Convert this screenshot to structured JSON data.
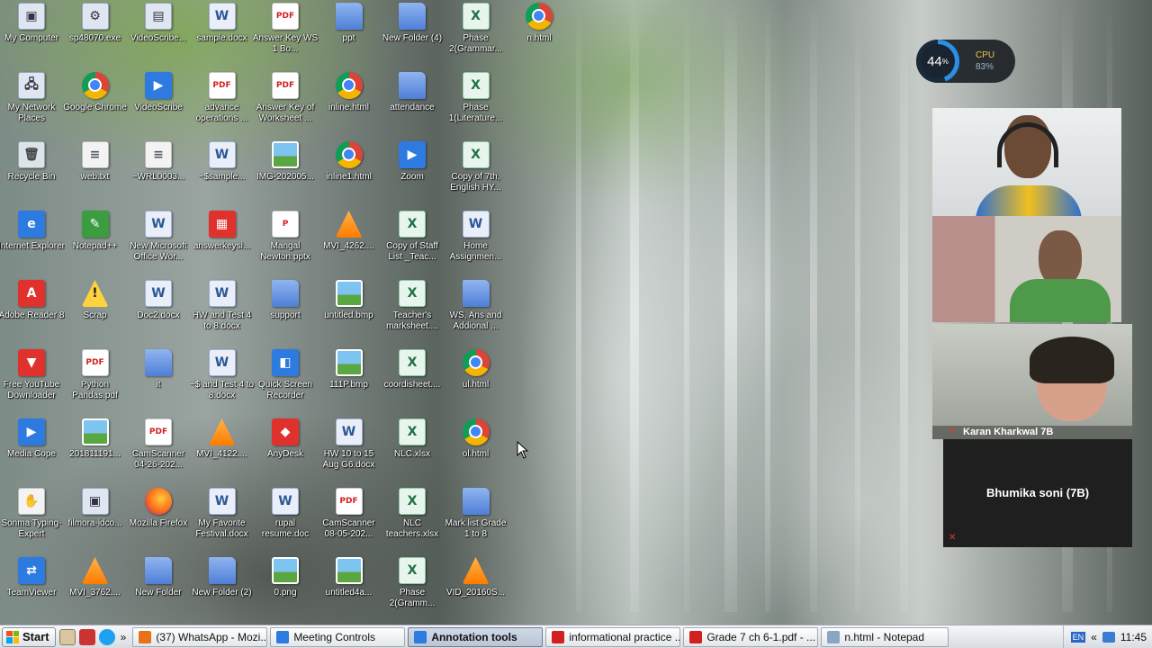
{
  "desktop": {
    "icons": [
      {
        "label": "My Computer",
        "type": "exe",
        "glyph": "▣"
      },
      {
        "label": "sp48070.exe",
        "type": "exe",
        "glyph": "⚙"
      },
      {
        "label": "VideoScribe...",
        "type": "exe",
        "glyph": "▤"
      },
      {
        "label": "sample.docx",
        "type": "word",
        "glyph": "W"
      },
      {
        "label": "Answer Key WS 1 Bo...",
        "type": "pdf",
        "glyph": "PDF"
      },
      {
        "label": "ppt",
        "type": "folder",
        "glyph": ""
      },
      {
        "label": "New Folder (4)",
        "type": "folder",
        "glyph": ""
      },
      {
        "label": "Phase 2(Grammar...",
        "type": "excel",
        "glyph": "X"
      },
      {
        "label": "n.html",
        "type": "chrome",
        "glyph": ""
      },
      {
        "label": "My Network Places",
        "type": "exe",
        "glyph": "🖧"
      },
      {
        "label": "Google Chrome",
        "type": "chrome",
        "glyph": ""
      },
      {
        "label": "VideoScribe",
        "type": "blue",
        "glyph": "▶"
      },
      {
        "label": "advance operations ...",
        "type": "pdf",
        "glyph": "PDF"
      },
      {
        "label": "Answer Key of Worksheet ...",
        "type": "pdf",
        "glyph": "PDF"
      },
      {
        "label": "inline.html",
        "type": "chrome",
        "glyph": ""
      },
      {
        "label": "attendance",
        "type": "folder",
        "glyph": ""
      },
      {
        "label": "Phase 1(Literature...",
        "type": "excel",
        "glyph": "X"
      },
      {
        "label": "Recycle Bin",
        "type": "bin",
        "glyph": "🗑"
      },
      {
        "label": "web.txt",
        "type": "txt",
        "glyph": "≡"
      },
      {
        "label": "~WRL0003...",
        "type": "txt",
        "glyph": "≡"
      },
      {
        "label": "~$sample...",
        "type": "word",
        "glyph": "W"
      },
      {
        "label": "IMG-202005...",
        "type": "img",
        "glyph": ""
      },
      {
        "label": "inline1.html",
        "type": "chrome",
        "glyph": ""
      },
      {
        "label": "Zoom",
        "type": "blue",
        "glyph": "▶"
      },
      {
        "label": "Copy of 7th, English HY...",
        "type": "excel",
        "glyph": "X"
      },
      {
        "label": "Internet Explorer",
        "type": "blue",
        "glyph": "e"
      },
      {
        "label": "Notepad++",
        "type": "green",
        "glyph": "✎"
      },
      {
        "label": "New Microsoft Office Wor...",
        "type": "word",
        "glyph": "W"
      },
      {
        "label": "answerkeysi...",
        "type": "red",
        "glyph": "▦"
      },
      {
        "label": "Mangal Newton.pptx",
        "type": "pdf",
        "glyph": "P"
      },
      {
        "label": "MVI_4262....",
        "type": "vlc",
        "glyph": ""
      },
      {
        "label": "Copy of Staff List _Teac...",
        "type": "excel",
        "glyph": "X"
      },
      {
        "label": "Home Assignmen...",
        "type": "word",
        "glyph": "W"
      },
      {
        "label": "Adobe Reader 8",
        "type": "red",
        "glyph": "A"
      },
      {
        "label": "Scrap",
        "type": "warn",
        "glyph": "!"
      },
      {
        "label": "Doc2.docx",
        "type": "word",
        "glyph": "W"
      },
      {
        "label": "HW and Test 4 to 8.docx",
        "type": "word",
        "glyph": "W"
      },
      {
        "label": "support",
        "type": "folder",
        "glyph": ""
      },
      {
        "label": "untitled.bmp",
        "type": "img",
        "glyph": ""
      },
      {
        "label": "Teacher's marksheet....",
        "type": "excel",
        "glyph": "X"
      },
      {
        "label": "WS, Ans and Addional ...",
        "type": "folder",
        "glyph": ""
      },
      {
        "label": "Free YouTube Downloader",
        "type": "red",
        "glyph": "▼"
      },
      {
        "label": "Python Pandas.pdf",
        "type": "pdf",
        "glyph": "PDF"
      },
      {
        "label": "",
        "type": "none",
        "glyph": ""
      },
      {
        "label": "~$ and Test 4 to 8.docx",
        "type": "word",
        "glyph": "W"
      },
      {
        "label": "Quick Screen Recorder",
        "type": "blue",
        "glyph": "◧"
      },
      {
        "label": "111P.bmp",
        "type": "img",
        "glyph": ""
      },
      {
        "label": "coordisheet....",
        "type": "excel",
        "glyph": "X"
      },
      {
        "label": "ul.html",
        "type": "chrome",
        "glyph": ""
      },
      {
        "label": "Media Cope",
        "type": "blue",
        "glyph": "▶"
      },
      {
        "label": "201811191...",
        "type": "img",
        "glyph": ""
      },
      {
        "label": "CamScanner 04-26-202...",
        "type": "pdf",
        "glyph": "PDF"
      },
      {
        "label": "MVI_4122....",
        "type": "vlc",
        "glyph": ""
      },
      {
        "label": "AnyDesk",
        "type": "red",
        "glyph": "◆"
      },
      {
        "label": "HW 10 to 15 Aug G6.docx",
        "type": "word",
        "glyph": "W"
      },
      {
        "label": "NLC.xlsx",
        "type": "excel",
        "glyph": "X"
      },
      {
        "label": "ol.html",
        "type": "chrome",
        "glyph": ""
      },
      {
        "label": "Sonma Typing-Expert",
        "type": "txt",
        "glyph": "✋"
      },
      {
        "label": "filmora-idco...",
        "type": "exe",
        "glyph": "▣"
      },
      {
        "label": "Mozilla Firefox",
        "type": "firefox",
        "glyph": ""
      },
      {
        "label": "My Favorite Festival.docx",
        "type": "word",
        "glyph": "W"
      },
      {
        "label": "rupal resume.doc",
        "type": "word",
        "glyph": "W"
      },
      {
        "label": "CamScanner 08-05-202...",
        "type": "pdf",
        "glyph": "PDF"
      },
      {
        "label": "NLC teachers.xlsx",
        "type": "excel",
        "glyph": "X"
      },
      {
        "label": "Mark list Grade 1 to 8",
        "type": "folder",
        "glyph": ""
      },
      {
        "label": "TeamViewer",
        "type": "blue",
        "glyph": "⇄"
      },
      {
        "label": "MVI_3762....",
        "type": "vlc",
        "glyph": ""
      },
      {
        "label": "New Folder",
        "type": "folder",
        "glyph": ""
      },
      {
        "label": "New Folder (2)",
        "type": "folder",
        "glyph": ""
      },
      {
        "label": "0.png",
        "type": "img",
        "glyph": ""
      },
      {
        "label": "untitled4a...",
        "type": "img",
        "glyph": ""
      },
      {
        "label": "Phase 2(Gramm...",
        "type": "excel",
        "glyph": "X"
      },
      {
        "label": "VID_20160S...",
        "type": "vlc",
        "glyph": ""
      }
    ],
    "extra_icon_it": {
      "label": "it",
      "type": "folder",
      "glyph": ""
    }
  },
  "cpu_widget": {
    "percent": "44",
    "percent_sign": "%",
    "label": "CPU",
    "value": "83",
    "value_sign": "%"
  },
  "zoom_panel": {
    "participants": [
      {
        "name": "",
        "muted": false
      },
      {
        "name": "",
        "muted": false
      },
      {
        "name": "Karan Kharkwal 7B",
        "muted": true
      },
      {
        "name": "Bhumika soni (7B)",
        "muted": true
      }
    ]
  },
  "taskbar": {
    "start_label": "Start",
    "chevron": "»",
    "tasks": [
      {
        "label": "(37) WhatsApp - Mozi...",
        "active": false,
        "icon_color": "#e8711c"
      },
      {
        "label": "Meeting Controls",
        "active": false,
        "icon_color": "#2d7be0"
      },
      {
        "label": "Annotation tools",
        "active": true,
        "icon_color": "#2d7be0"
      },
      {
        "label": "informational practice ...",
        "active": false,
        "icon_color": "#d21f1f"
      },
      {
        "label": "Grade 7 ch 6-1.pdf - ...",
        "active": false,
        "icon_color": "#d21f1f"
      },
      {
        "label": "n.html - Notepad",
        "active": false,
        "icon_color": "#8aa6c4"
      }
    ],
    "tray": {
      "lang": "EN",
      "chevron": "«",
      "clock": "11:45"
    }
  },
  "colors": {
    "accent": "#2b8fe8",
    "taskbar_active": "#b9c6d6",
    "muted": "#e33333"
  }
}
